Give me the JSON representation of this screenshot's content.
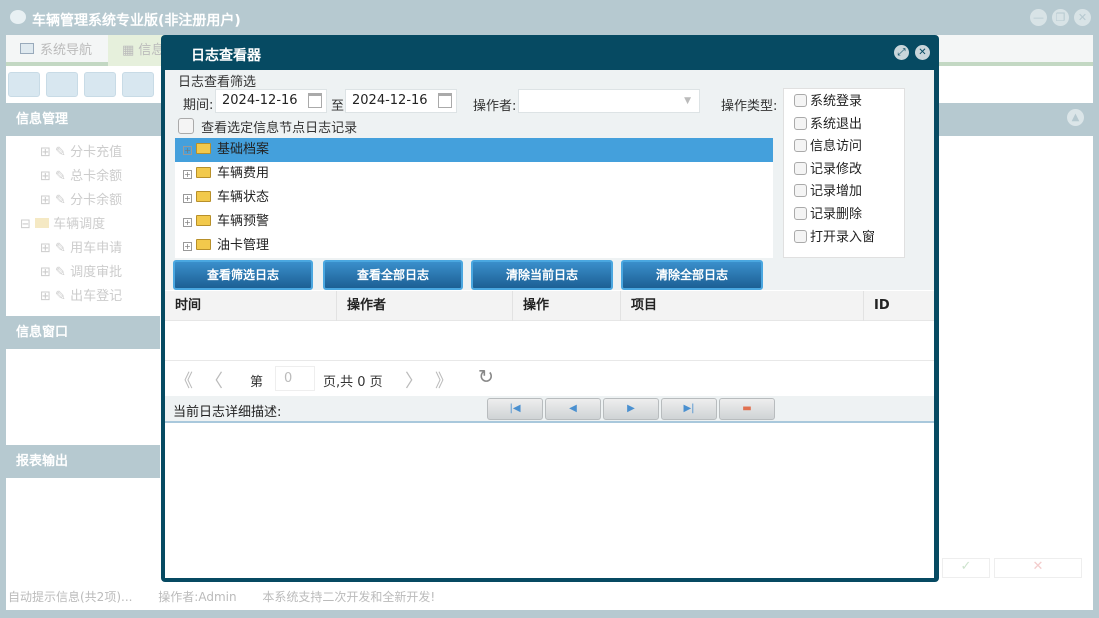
{
  "app": {
    "title": "车辆管理系统专业版(非注册用户)",
    "window_buttons": [
      "minimize-icon",
      "restore-icon",
      "close-icon"
    ]
  },
  "tabs": [
    {
      "label": "系统导航"
    },
    {
      "label": "信息"
    }
  ],
  "left_panel": {
    "sections": [
      "信息管理",
      "信息窗口",
      "报表输出"
    ],
    "items": [
      "分卡充值",
      "总卡余额",
      "分卡余额",
      "车辆调度",
      "用车申请",
      "调度审批",
      "出车登记"
    ]
  },
  "status_bar": {
    "hint": "自动提示信息(共2项)...",
    "operator": "操作者:Admin",
    "notice": "本系统支持二次开发和全新开发!"
  },
  "dialog": {
    "title": "日志查看器",
    "filter_title": "日志查看筛选",
    "period_label": "期间:",
    "date_from": "2024-12-16",
    "to_label": "至",
    "date_to": "2024-12-16",
    "operator_label": "操作者:",
    "operator_value": "",
    "optype_label": "操作类型:",
    "node_checkbox_label": "查看选定信息节点日志记录",
    "tree": [
      {
        "label": "基础档案",
        "selected": true
      },
      {
        "label": "车辆费用"
      },
      {
        "label": "车辆状态"
      },
      {
        "label": "车辆预警"
      },
      {
        "label": "油卡管理"
      }
    ],
    "op_types": [
      "系统登录",
      "系统退出",
      "信息访问",
      "记录修改",
      "记录增加",
      "记录删除",
      "打开录入窗"
    ],
    "buttons": [
      "查看筛选日志",
      "查看全部日志",
      "清除当前日志",
      "清除全部日志"
    ],
    "columns": [
      "时间",
      "操作者",
      "操作",
      "项目",
      "ID"
    ],
    "pager": {
      "page_prefix": "第",
      "page_value": "0",
      "page_suffix": "页,共 0 页"
    },
    "detail_label": "当前日志详细描述:",
    "accent": "#064a62"
  }
}
